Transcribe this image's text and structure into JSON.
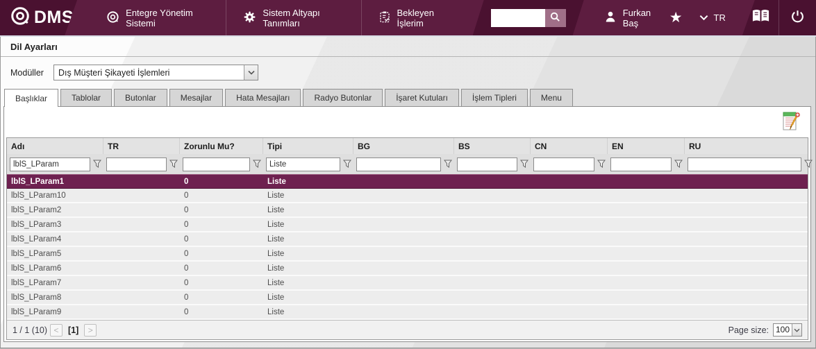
{
  "colors": {
    "navbar": "#5d1d40",
    "navbar_dark": "#4a1130",
    "accent_selected_row": "#6e2150",
    "search_button": "#a06f88"
  },
  "navbar": {
    "logo_text": "DMS",
    "menu_items": [
      {
        "label": "Entegre Yönetim Sistemi",
        "icon": "qdms-circle-icon"
      },
      {
        "label": "Sistem Altyapı Tanımları",
        "icon": "gear-icon"
      },
      {
        "label": "Bekleyen İşlerim",
        "icon": "clipboard-check-icon"
      }
    ],
    "search_value": "",
    "user_name": "Furkan Baş",
    "language": "TR"
  },
  "page_title": "Dil Ayarları",
  "module_selector": {
    "label": "Modüller",
    "value": "Dış Müşteri Şikayeti İşlemleri"
  },
  "tabs": [
    {
      "label": "Başlıklar",
      "active": true
    },
    {
      "label": "Tablolar"
    },
    {
      "label": "Butonlar"
    },
    {
      "label": "Mesajlar"
    },
    {
      "label": "Hata Mesajları"
    },
    {
      "label": "Radyo Butonlar"
    },
    {
      "label": "İşaret Kutuları"
    },
    {
      "label": "İşlem Tipleri"
    },
    {
      "label": "Menu"
    }
  ],
  "grid": {
    "columns": [
      "Adı",
      "TR",
      "Zorunlu Mu?",
      "Tipi",
      "BG",
      "BS",
      "CN",
      "EN",
      "RU"
    ],
    "filters": [
      "lblS_LParam",
      "",
      "",
      "Liste",
      "",
      "",
      "",
      "",
      ""
    ],
    "rows": [
      {
        "adi": "lblS_LParam1",
        "zorunlu": "0",
        "tipi": "Liste",
        "selected": true
      },
      {
        "adi": "lblS_LParam10",
        "zorunlu": "0",
        "tipi": "Liste"
      },
      {
        "adi": "lblS_LParam2",
        "zorunlu": "0",
        "tipi": "Liste"
      },
      {
        "adi": "lblS_LParam3",
        "zorunlu": "0",
        "tipi": "Liste"
      },
      {
        "adi": "lblS_LParam4",
        "zorunlu": "0",
        "tipi": "Liste"
      },
      {
        "adi": "lblS_LParam5",
        "zorunlu": "0",
        "tipi": "Liste"
      },
      {
        "adi": "lblS_LParam6",
        "zorunlu": "0",
        "tipi": "Liste"
      },
      {
        "adi": "lblS_LParam7",
        "zorunlu": "0",
        "tipi": "Liste"
      },
      {
        "adi": "lblS_LParam8",
        "zorunlu": "0",
        "tipi": "Liste"
      },
      {
        "adi": "lblS_LParam9",
        "zorunlu": "0",
        "tipi": "Liste"
      }
    ]
  },
  "pager": {
    "summary": "1 / 1 (10)",
    "prev": "<",
    "current": "[1]",
    "next": ">",
    "page_size_label": "Page size:",
    "page_size": "100"
  }
}
